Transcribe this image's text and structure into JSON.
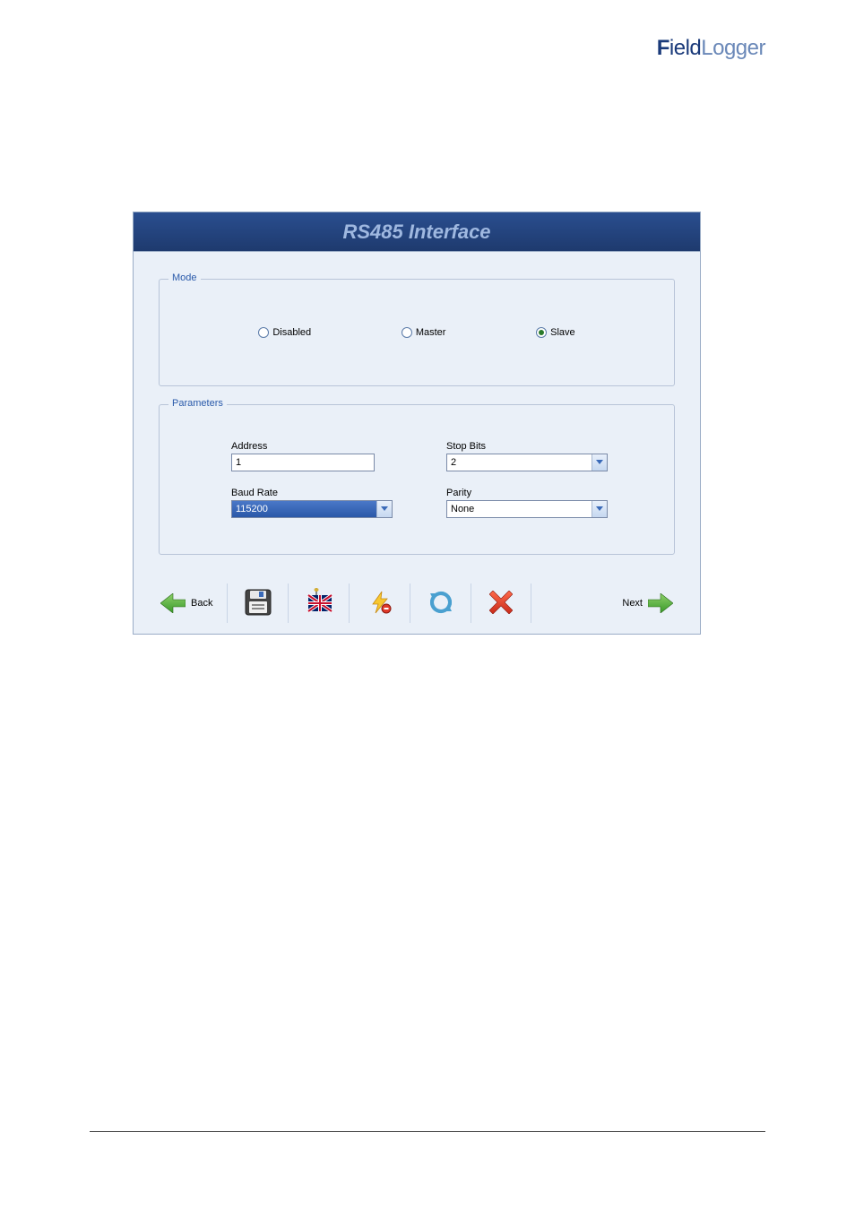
{
  "brand": {
    "part1": "F",
    "part2": "ield",
    "part3": "Logger"
  },
  "window": {
    "title": "RS485 Interface"
  },
  "mode": {
    "legend": "Mode",
    "options": {
      "disabled": {
        "label": "Disabled",
        "selected": false
      },
      "master": {
        "label": "Master",
        "selected": false
      },
      "slave": {
        "label": "Slave",
        "selected": true
      }
    }
  },
  "parameters": {
    "legend": "Parameters",
    "address": {
      "label": "Address",
      "value": "1"
    },
    "baud_rate": {
      "label": "Baud Rate",
      "value": "115200"
    },
    "stop_bits": {
      "label": "Stop Bits",
      "value": "2"
    },
    "parity": {
      "label": "Parity",
      "value": "None"
    }
  },
  "nav": {
    "back": "Back",
    "next": "Next"
  },
  "icons": {
    "back_arrow": "back-arrow-icon",
    "next_arrow": "next-arrow-icon",
    "save": "floppy-save-icon",
    "language": "uk-flag-icon",
    "quick_config": "lightning-icon",
    "refresh": "refresh-icon",
    "cancel": "red-x-icon"
  }
}
